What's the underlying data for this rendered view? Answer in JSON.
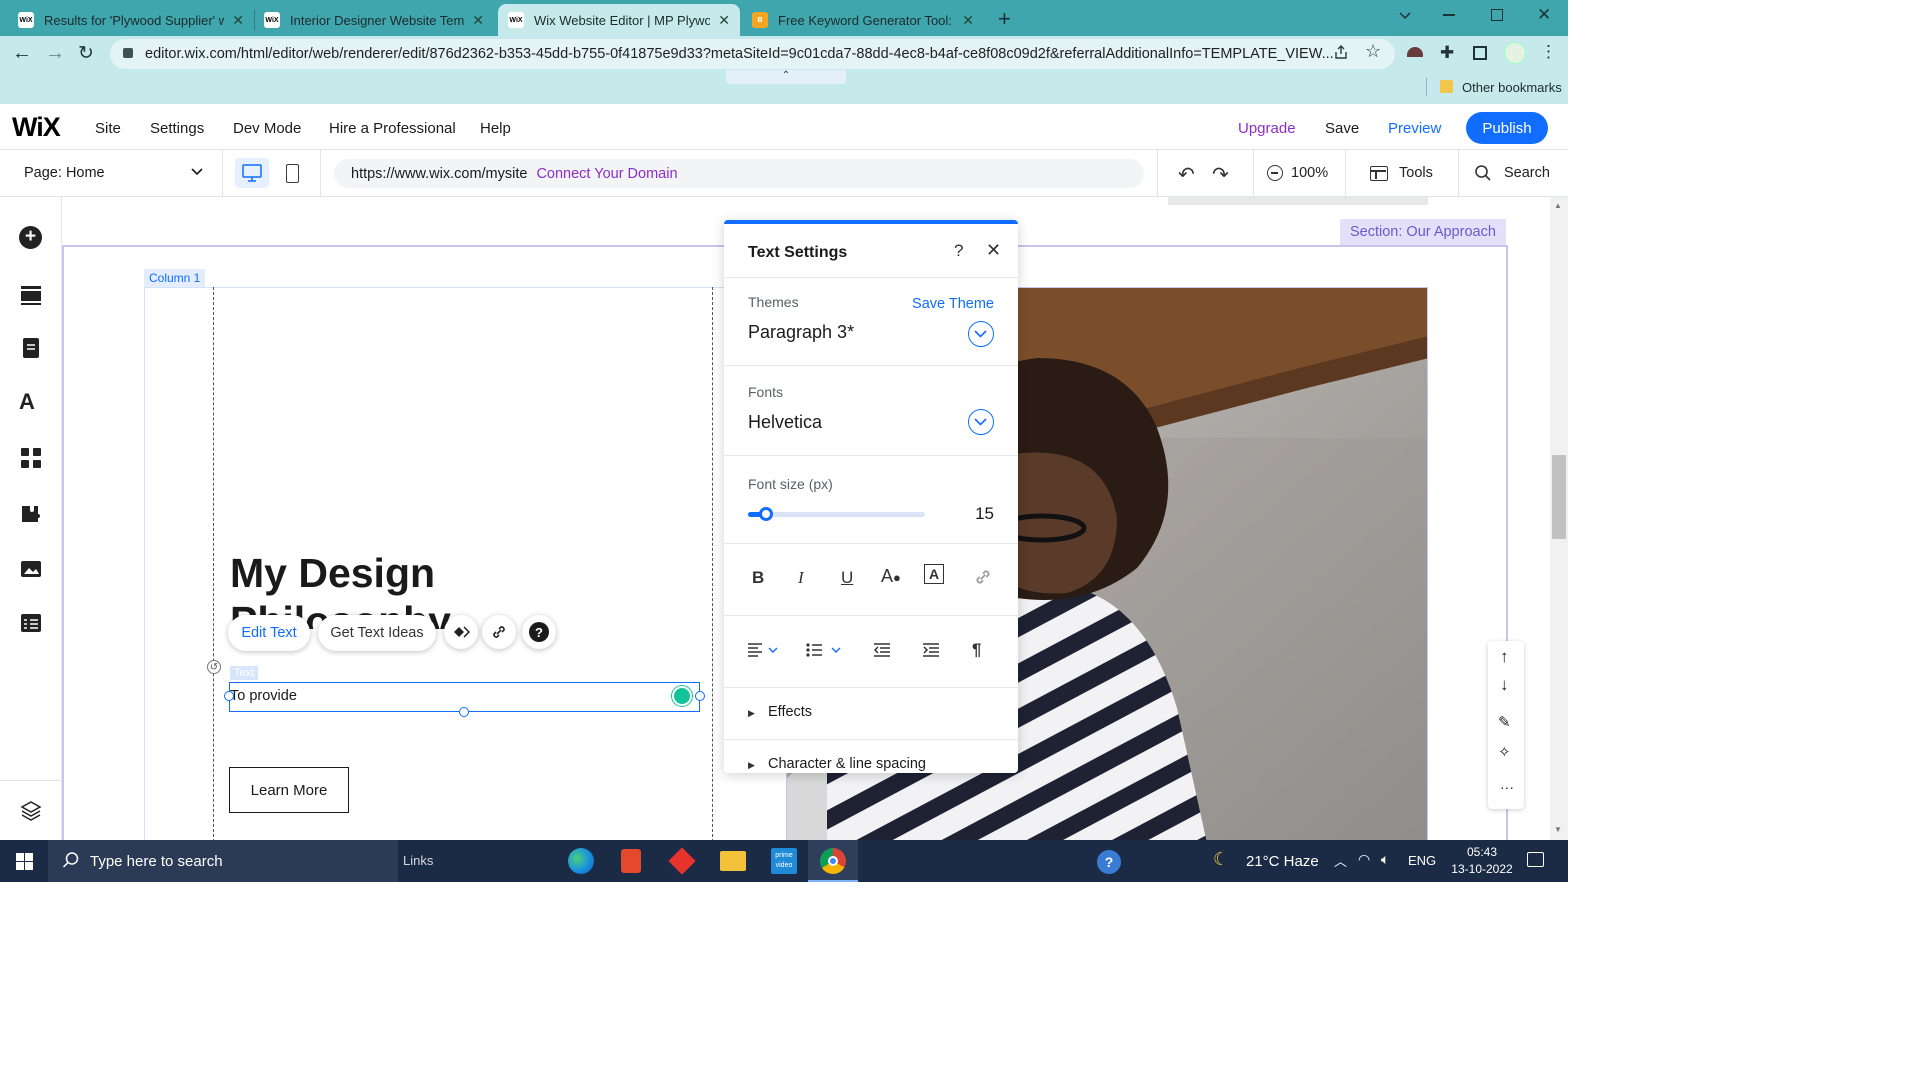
{
  "browser": {
    "tabs": [
      {
        "title": "Results for 'Plywood Supplier' we",
        "favicon": "WiX"
      },
      {
        "title": "Interior Designer Website Templa",
        "favicon": "WiX"
      },
      {
        "title": "Wix Website Editor | MP Plywood",
        "favicon": "WiX"
      },
      {
        "title": "Free Keyword Generator Tool: Fin",
        "favicon": "B"
      }
    ],
    "active_tab": 2,
    "url": "editor.wix.com/html/editor/web/renderer/edit/876d2362-b353-45dd-b755-0f41875e9d33?metaSiteId=9c01cda7-88dd-4ec8-b4af-ce8f08c09d2f&referralAdditionalInfo=TEMPLATE_VIEW...",
    "other_bookmarks": "Other bookmarks"
  },
  "wix": {
    "logo": "WiX",
    "menu": [
      "Site",
      "Settings",
      "Dev Mode",
      "Hire a Professional",
      "Help"
    ],
    "upgrade": "Upgrade",
    "save": "Save",
    "preview": "Preview",
    "publish": "Publish",
    "page_label": "Page:",
    "page_name": "Home",
    "site_url": "https://www.wix.com/mysite",
    "connect_domain": "Connect Your Domain",
    "zoom": "100%",
    "tools": "Tools",
    "search": "Search"
  },
  "canvas": {
    "section_label": "Section: Our Approach",
    "column_label": "Column 1",
    "heading_line1": "My Design",
    "heading_line2": "Philosophy",
    "edit_text": "Edit Text",
    "get_text_ideas": "Get Text Ideas",
    "text_tag": "Text",
    "text_content": "To provide",
    "learn_more": "Learn More"
  },
  "text_settings": {
    "title": "Text Settings",
    "themes_label": "Themes",
    "save_theme": "Save Theme",
    "theme_value": "Paragraph 3*",
    "fonts_label": "Fonts",
    "font_value": "Helvetica",
    "font_size_label": "Font size (px)",
    "font_size_value": "15",
    "font_size_slider_fraction": 0.04,
    "effects": "Effects",
    "char_spacing": "Character & line spacing"
  },
  "taskbar": {
    "search_placeholder": "Type here to search",
    "links": "Links",
    "weather": "21°C  Haze",
    "lang": "ENG",
    "time": "05:43",
    "date": "13-10-2022"
  },
  "colors": {
    "wix_blue": "#116dff",
    "purple": "#8b2fc9",
    "chrome_teal": "#3fa6ad"
  }
}
